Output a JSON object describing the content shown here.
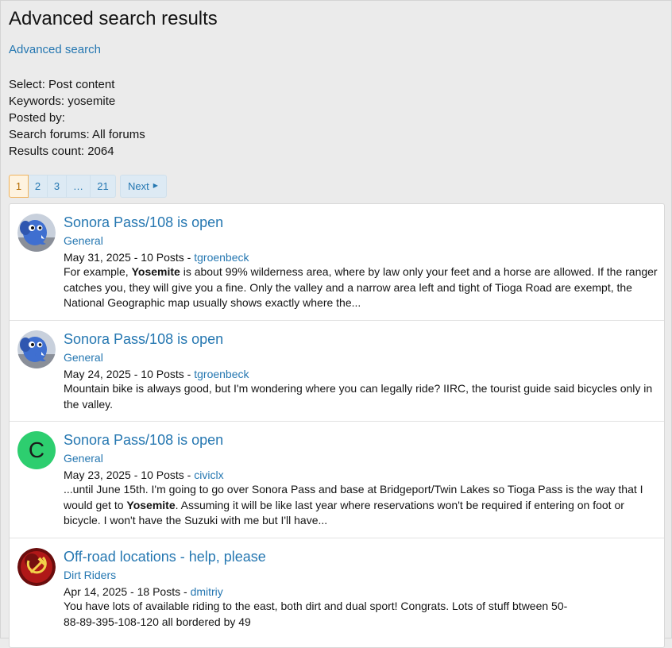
{
  "page": {
    "title": "Advanced search results",
    "advanced_search_link": "Advanced search"
  },
  "criteria": {
    "select": "Select: Post content",
    "keywords": "Keywords: yosemite",
    "posted_by": "Posted by:",
    "search_forums": "Search forums: All forums",
    "results_count": "Results count: 2064"
  },
  "pagination": {
    "pages": [
      "1",
      "2",
      "3",
      "…",
      "21"
    ],
    "current": "1",
    "next_label": "Next",
    "next_icon": "chevron-right-icon"
  },
  "results": [
    {
      "title": "Sonora Pass/108 is open",
      "forum": "General",
      "date": "May 31, 2025",
      "posts": "10 Posts",
      "user": "tgroenbeck",
      "avatar": "elephant-avatar",
      "snippet_before": "For example, ",
      "snippet_bold": "Yosemite",
      "snippet_after": " is about 99% wilderness area, where by law only your feet and a horse are allowed. If the ranger catches you, they will give you a fine. Only the valley and a narrow area left and tight of Tioga Road are exempt, the National Geographic map usually shows exactly where the..."
    },
    {
      "title": "Sonora Pass/108 is open",
      "forum": "General",
      "date": "May 24, 2025",
      "posts": "10 Posts",
      "user": "tgroenbeck",
      "avatar": "elephant-avatar",
      "snippet_before": "Mountain bike is always good, but I'm wondering where you can legally ride? IIRC, the tourist guide said bicycles only in the valley.",
      "snippet_bold": "",
      "snippet_after": ""
    },
    {
      "title": "Sonora Pass/108 is open",
      "forum": "General",
      "date": "May 23, 2025",
      "posts": "10 Posts",
      "user": "civiclx",
      "avatar_letter": "C",
      "avatar_color": "#2dce6f",
      "snippet_before": "...until June 15th. I'm going to go over Sonora Pass and base at Bridgeport/Twin Lakes so Tioga Pass is the way that I would get to ",
      "snippet_bold": "Yosemite",
      "snippet_after": ". Assuming it will be like last year where reservations won't be required if entering on foot or bicycle. I won't have the Suzuki with me but I'll have..."
    },
    {
      "title": "Off-road locations - help, please",
      "forum": "Dirt Riders",
      "date": "Apr 14, 2025",
      "posts": "18 Posts",
      "user": "dmitriy",
      "avatar": "hammer-sickle-avatar",
      "snippet_before": "You have lots of available riding to the east, both dirt and dual sport! Congrats. Lots of stuff btween 50-88-89-395-108-120 all bordered by 49",
      "snippet_bold": "",
      "snippet_after": ""
    }
  ],
  "separators": {
    "meta_sep": " - "
  },
  "colors": {
    "link": "#2577b1",
    "background": "#ebebeb",
    "pager_current_border": "#f0b35d"
  }
}
